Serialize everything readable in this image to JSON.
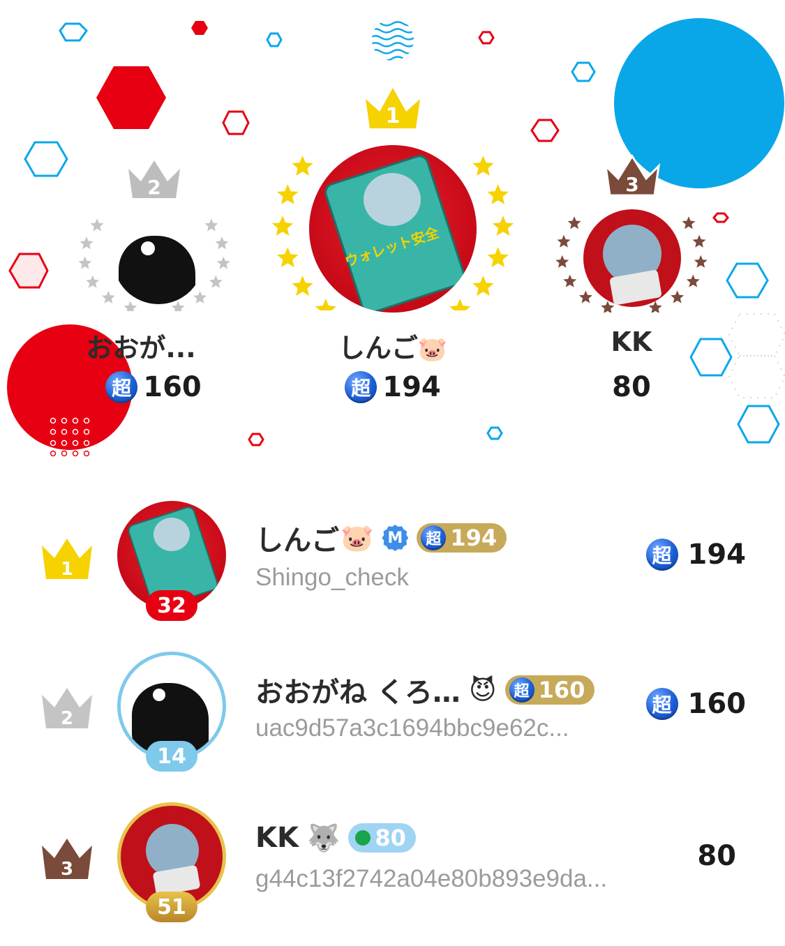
{
  "podium": [
    {
      "rank": "1",
      "name": "しんご",
      "emoji": "🐷",
      "score": "194",
      "super": "超",
      "color": "#f5d200"
    },
    {
      "rank": "2",
      "name": "おおが...",
      "score": "160",
      "super": "超",
      "color": "#bdbdbd"
    },
    {
      "rank": "3",
      "name": "KK",
      "score": "80",
      "color": "#7a4a3a"
    }
  ],
  "avatar_text": "ウォレット安全",
  "list": [
    {
      "rank": "1",
      "name": "しんご",
      "emoji": "🐷",
      "badge_m": "M",
      "pill_super": "超",
      "pill_value": "194",
      "handle": "Shingo_check",
      "level": "32",
      "score_super": "超",
      "score": "194"
    },
    {
      "rank": "2",
      "name": "おおがね くろ…",
      "emoji": "😈",
      "pill_super": "超",
      "pill_value": "160",
      "handle": "uac9d57a3c1694bbc9e62c...",
      "level": "14",
      "score_super": "超",
      "score": "160"
    },
    {
      "rank": "3",
      "name": "KK",
      "emoji": "🐺",
      "pill_value": "80",
      "handle": "g44c13f2742a04e80b893e9da...",
      "level": "51",
      "score": "80"
    }
  ],
  "colors": {
    "gold": "#f5d200",
    "silver": "#c4c4c4",
    "bronze": "#7a4a3a",
    "red": "#e60012",
    "blue": "#0aa7e8"
  }
}
